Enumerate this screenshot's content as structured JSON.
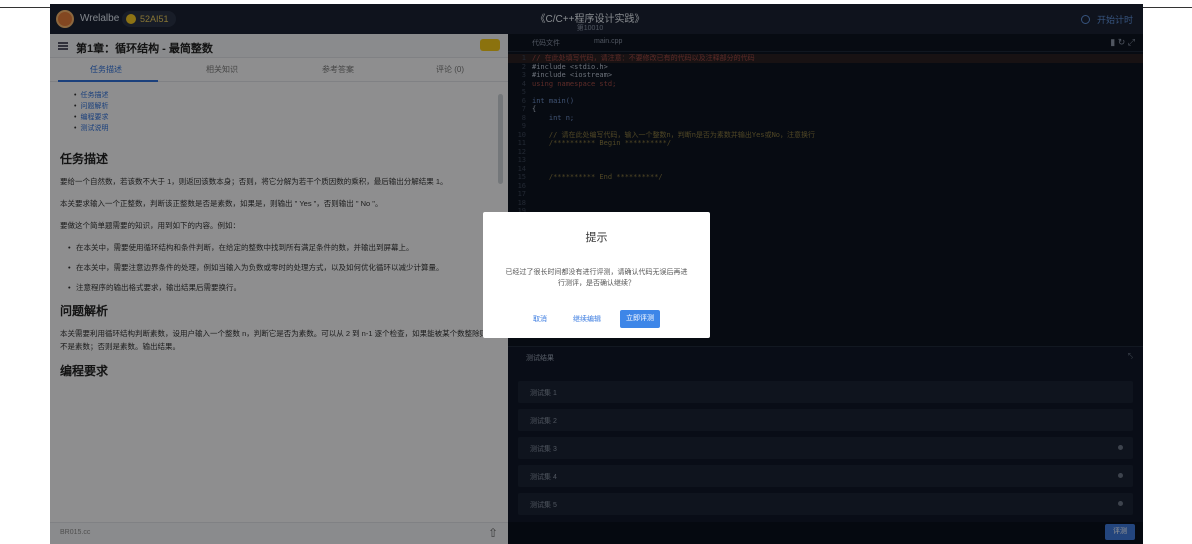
{
  "header": {
    "username": "Wrelalbe",
    "coin_badge": "52AI51",
    "title": "《C/C++程序设计实践》",
    "subtitle": "第10010",
    "right_label": "开始计时"
  },
  "problem": {
    "title": "第1章：循环结构 - 最简整数",
    "tabs": [
      "任务描述",
      "相关知识",
      "参考答案",
      "评论 (0)"
    ],
    "toc": [
      "任务描述",
      "问题解析",
      "编程要求",
      "测试说明"
    ],
    "sections": [
      {
        "heading": "任务描述",
        "paragraphs": [
          "要给一个自然数，若该数不大于 1，则返回该数本身；否则，将它分解为若干个质因数的乘积，最后输出分解结果 1。",
          "本关要求输入一个正整数，判断该正整数是否是素数，如果是，则输出 \" Yes \"，否则输出 \" No \"。",
          "要做这个简单题需要的知识，用到如下的内容。例如："
        ],
        "bullets": [
          "在本关中，需要使用循环结构和条件判断，在给定的整数中找到所有满足条件的数，并输出到屏幕上。",
          "在本关中，需要注意边界条件的处理，例如当输入为负数或零时的处理方式，以及如何优化循环以减少计算量。",
          "注意程序的输出格式要求，输出结果后需要换行。"
        ]
      },
      {
        "heading": "问题解析",
        "paragraphs": [
          "本关需要利用循环结构判断素数，设用户输入一个整数 n，判断它是否为素数。可以从 2 到 n-1 逐个检查，如果能被某个数整除则不是素数；否则是素数。输出结果。"
        ],
        "bullets": []
      },
      {
        "heading": "编程要求",
        "paragraphs": [],
        "bullets": []
      }
    ],
    "footer_left": "BR015.cc",
    "footer_right": "⇧"
  },
  "editor": {
    "tabs": [
      "代码文件",
      "main.cpp"
    ],
    "toolbar_icons": [
      "file-icon",
      "refresh-icon",
      "expand-icon"
    ],
    "lines": [
      {
        "num": "1",
        "text": "// 在此处填写代码，请注意：不要修改已有的代码以及注释部分的代码",
        "kind": "comment",
        "hl": true
      },
      {
        "num": "2",
        "text": "#include <stdio.h>",
        "kind": "pp"
      },
      {
        "num": "3",
        "text": "#include <iostream>",
        "kind": "pp"
      },
      {
        "num": "4",
        "text": "using namespace std;",
        "kind": "comment"
      },
      {
        "num": "5",
        "text": "",
        "kind": "pp"
      },
      {
        "num": "6",
        "text": "int main()",
        "kind": "kw"
      },
      {
        "num": "7",
        "text": "{",
        "kind": "pp"
      },
      {
        "num": "8",
        "text": "    int n;",
        "kind": "kw"
      },
      {
        "num": "9",
        "text": "",
        "kind": "pp"
      },
      {
        "num": "10",
        "text": "    // 请在此处编写代码，输入一个整数n，判断n是否为素数并输出Yes或No，注意换行",
        "kind": "str"
      },
      {
        "num": "11",
        "text": "    /********** Begin **********/",
        "kind": "str"
      },
      {
        "num": "12",
        "text": "",
        "kind": "pp"
      },
      {
        "num": "13",
        "text": "",
        "kind": "pp"
      },
      {
        "num": "14",
        "text": "",
        "kind": "pp"
      },
      {
        "num": "15",
        "text": "    /********** End **********/",
        "kind": "str"
      },
      {
        "num": "16",
        "text": "",
        "kind": "pp"
      },
      {
        "num": "17",
        "text": "",
        "kind": "pp"
      },
      {
        "num": "18",
        "text": "",
        "kind": "pp"
      },
      {
        "num": "19",
        "text": "",
        "kind": "pp"
      }
    ]
  },
  "tests": {
    "header": "测试结果",
    "items": [
      "测试集 1",
      "测试集 2",
      "测试集 3",
      "测试集 4",
      "测试集 5"
    ],
    "submit_label": "评测"
  },
  "dialog": {
    "title": "提示",
    "message": "已经过了很长时间都没有进行评测，请确认代码无误后再进行测评，是否确认继续？",
    "cancel": "取消",
    "continue": "继续编辑",
    "confirm": "立即评测"
  },
  "colors": {
    "accent": "#3d86e8",
    "editor_bg": "#0d1420",
    "overlay": "rgba(0,0,0,0.42)"
  }
}
